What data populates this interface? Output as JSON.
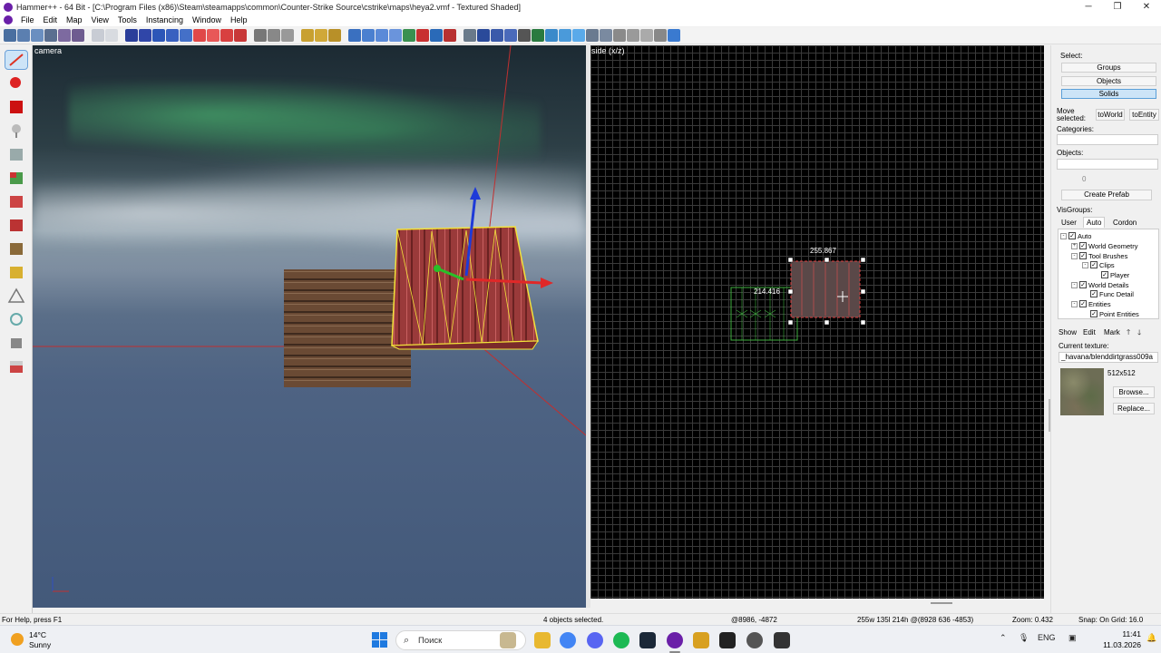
{
  "window": {
    "title": "Hammer++ - 64 Bit - [C:\\Program Files (x86)\\Steam\\steamapps\\common\\Counter-Strike Source\\cstrike\\maps\\heya2.vmf - Textured Shaded]",
    "controls": [
      "─",
      "❐",
      "✕"
    ]
  },
  "menu": [
    "File",
    "Edit",
    "Map",
    "View",
    "Tools",
    "Instancing",
    "Window",
    "Help"
  ],
  "views": {
    "camera_label": "camera",
    "side_label": "side (x/z)",
    "dim_width": "255.867",
    "dim_height": "214.416"
  },
  "panel": {
    "select_label": "Select:",
    "select_buttons": [
      "Groups",
      "Objects",
      "Solids"
    ],
    "select_active": "Solids",
    "move_selected_label_1": "Move",
    "move_selected_label_2": "selected:",
    "to_world": "toWorld",
    "to_entity": "toEntity",
    "categories_label": "Categories:",
    "objects_label": "Objects:",
    "objects_count": "0",
    "create_prefab": "Create Prefab",
    "visgroups_label": "VisGroups:",
    "visgroup_tabs": [
      "User",
      "Auto",
      "Cordon"
    ],
    "visgroup_active_tab": "Auto",
    "tree": [
      {
        "label": "Auto",
        "depth": 0,
        "expander": "-",
        "checked": true
      },
      {
        "label": "World Geometry",
        "depth": 1,
        "expander": "+",
        "checked": true
      },
      {
        "label": "Tool Brushes",
        "depth": 1,
        "expander": "-",
        "checked": true
      },
      {
        "label": "Clips",
        "depth": 2,
        "expander": "-",
        "checked": true
      },
      {
        "label": "Player",
        "depth": 3,
        "expander": "",
        "checked": true
      },
      {
        "label": "World Details",
        "depth": 1,
        "expander": "-",
        "checked": true
      },
      {
        "label": "Func Detail",
        "depth": 2,
        "expander": "",
        "checked": true
      },
      {
        "label": "Entities",
        "depth": 1,
        "expander": "-",
        "checked": true
      },
      {
        "label": "Point Entities",
        "depth": 2,
        "expander": "",
        "checked": true
      }
    ],
    "show_btn": "Show",
    "edit_btn": "Edit",
    "mark_btn": "Mark",
    "up_btn": "🡑",
    "down_btn": "🡓",
    "current_texture_label": "Current texture:",
    "texture_name": "_havana/blenddirtgrass009a",
    "texture_size": "512x512",
    "browse_btn": "Browse...",
    "replace_btn": "Replace..."
  },
  "status": {
    "help": "For Help, press F1",
    "selection": "4 objects selected.",
    "coords": "@8986, -4872",
    "size": "255w 135l 214h @(8928 636 -4853)",
    "zoom": "Zoom: 0.432",
    "snap": "Snap: On Grid: 16.0"
  },
  "taskbar": {
    "temperature": "14°C",
    "condition": "Sunny",
    "search_placeholder": "Поиск",
    "language": "ENG",
    "time": "11:41",
    "date": "11.03.2026"
  },
  "colors": {
    "accent": "#6a1fa8",
    "selection_yellow": "#f2e23a",
    "selection_red": "#e04040",
    "grid_line": "#3a3a3a",
    "brush_green": "#3fae3f"
  }
}
